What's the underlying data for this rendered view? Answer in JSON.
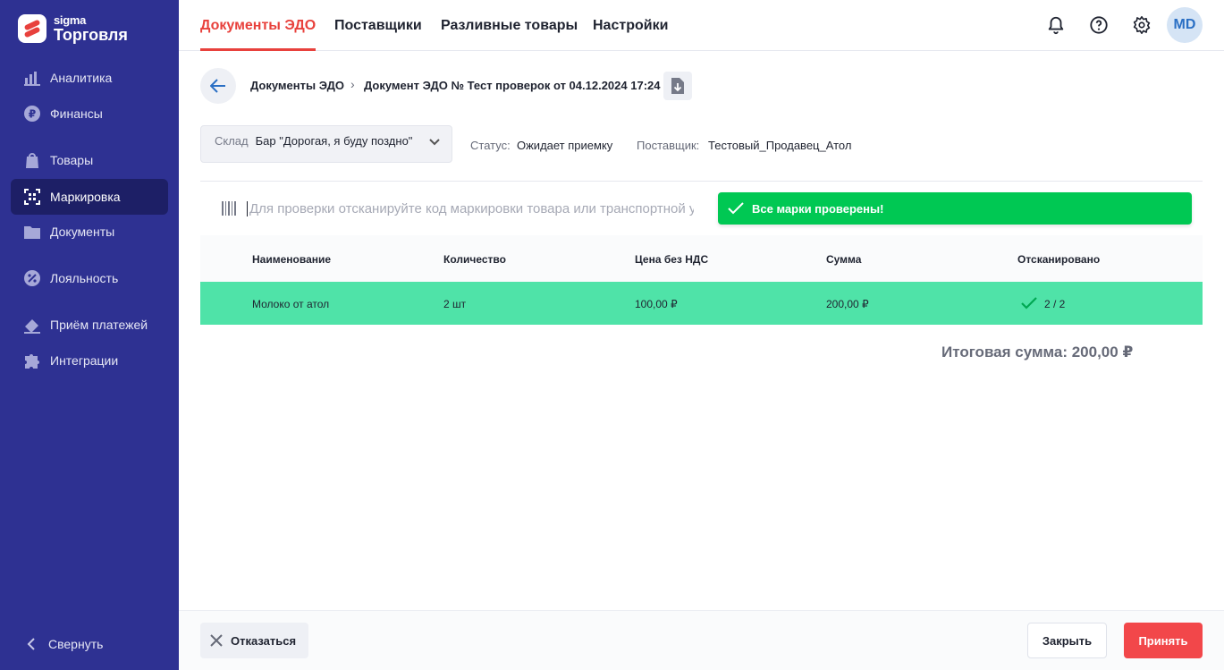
{
  "app": {
    "brand_small": "sigma",
    "brand_big": "Торговля"
  },
  "sidebar": {
    "items": [
      {
        "label": "Аналитика",
        "icon": "analytics-icon"
      },
      {
        "label": "Финансы",
        "icon": "ruble-icon"
      },
      {
        "label": "Товары",
        "icon": "shopping-bag-icon"
      },
      {
        "label": "Маркировка",
        "icon": "marking-qr-icon",
        "active": true
      },
      {
        "label": "Документы",
        "icon": "folder-icon"
      },
      {
        "label": "Лояльность",
        "icon": "percent-badge-icon"
      },
      {
        "label": "Приём платежей",
        "icon": "payment-icon"
      },
      {
        "label": "Интеграции",
        "icon": "puzzle-icon"
      }
    ],
    "collapse_label": "Свернуть"
  },
  "header": {
    "tabs": [
      {
        "label": "Документы ЭДО",
        "active": true
      },
      {
        "label": "Поставщики"
      },
      {
        "label": "Разливные товары"
      },
      {
        "label": "Настройки"
      }
    ],
    "avatar_initials": "MD"
  },
  "breadcrumb": {
    "parent": "Документы ЭДО",
    "current": "Документ ЭДО № Тест проверок от 04.12.2024 17:24"
  },
  "filters": {
    "warehouse_label": "Склад",
    "warehouse_value": "Бар \"Дорогая, я буду поздно\"",
    "status_label": "Статус:",
    "status_value": "Ожидает приемку",
    "supplier_label": "Поставщик:",
    "supplier_value": "Тестовый_Продавец_Атол"
  },
  "scan": {
    "placeholder": "Для проверки отсканируйте код маркировки товара или транспортной упаковки",
    "value": ""
  },
  "banner": {
    "text": "Все марки проверены!"
  },
  "table": {
    "columns": [
      "Наименование",
      "Количество",
      "Цена без НДС",
      "Сумма",
      "Отсканировано"
    ],
    "rows": [
      {
        "name": "Молоко от атол",
        "qty": "2 шт",
        "price": "100,00 ₽",
        "sum": "200,00 ₽",
        "scanned": "2 / 2"
      }
    ]
  },
  "total": "Итоговая сумма: 200,00 ₽",
  "footer": {
    "decline": "Отказаться",
    "close": "Закрыть",
    "accept": "Принять"
  },
  "colors": {
    "sidebar": "#2e3192",
    "accent": "#e8413c",
    "success": "#00c853",
    "row_highlight": "#4fe3a8"
  }
}
